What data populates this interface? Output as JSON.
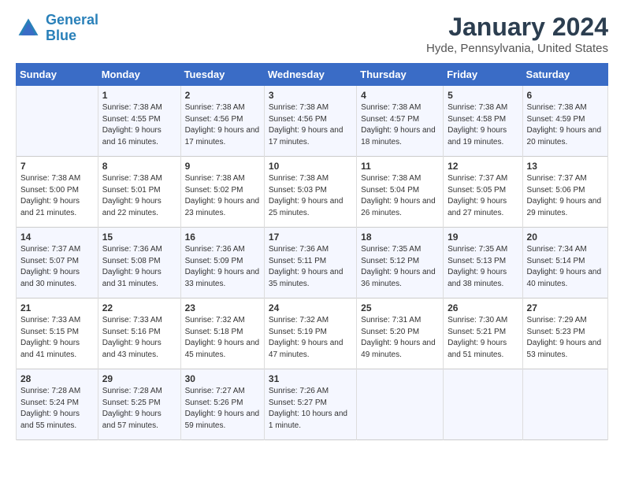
{
  "logo": {
    "line1": "General",
    "line2": "Blue"
  },
  "calendar": {
    "title": "January 2024",
    "subtitle": "Hyde, Pennsylvania, United States"
  },
  "weekdays": [
    "Sunday",
    "Monday",
    "Tuesday",
    "Wednesday",
    "Thursday",
    "Friday",
    "Saturday"
  ],
  "weeks": [
    [
      {
        "day": "",
        "sunrise": "",
        "sunset": "",
        "daylight": ""
      },
      {
        "day": "1",
        "sunrise": "Sunrise: 7:38 AM",
        "sunset": "Sunset: 4:55 PM",
        "daylight": "Daylight: 9 hours and 16 minutes."
      },
      {
        "day": "2",
        "sunrise": "Sunrise: 7:38 AM",
        "sunset": "Sunset: 4:56 PM",
        "daylight": "Daylight: 9 hours and 17 minutes."
      },
      {
        "day": "3",
        "sunrise": "Sunrise: 7:38 AM",
        "sunset": "Sunset: 4:56 PM",
        "daylight": "Daylight: 9 hours and 17 minutes."
      },
      {
        "day": "4",
        "sunrise": "Sunrise: 7:38 AM",
        "sunset": "Sunset: 4:57 PM",
        "daylight": "Daylight: 9 hours and 18 minutes."
      },
      {
        "day": "5",
        "sunrise": "Sunrise: 7:38 AM",
        "sunset": "Sunset: 4:58 PM",
        "daylight": "Daylight: 9 hours and 19 minutes."
      },
      {
        "day": "6",
        "sunrise": "Sunrise: 7:38 AM",
        "sunset": "Sunset: 4:59 PM",
        "daylight": "Daylight: 9 hours and 20 minutes."
      }
    ],
    [
      {
        "day": "7",
        "sunrise": "Sunrise: 7:38 AM",
        "sunset": "Sunset: 5:00 PM",
        "daylight": "Daylight: 9 hours and 21 minutes."
      },
      {
        "day": "8",
        "sunrise": "Sunrise: 7:38 AM",
        "sunset": "Sunset: 5:01 PM",
        "daylight": "Daylight: 9 hours and 22 minutes."
      },
      {
        "day": "9",
        "sunrise": "Sunrise: 7:38 AM",
        "sunset": "Sunset: 5:02 PM",
        "daylight": "Daylight: 9 hours and 23 minutes."
      },
      {
        "day": "10",
        "sunrise": "Sunrise: 7:38 AM",
        "sunset": "Sunset: 5:03 PM",
        "daylight": "Daylight: 9 hours and 25 minutes."
      },
      {
        "day": "11",
        "sunrise": "Sunrise: 7:38 AM",
        "sunset": "Sunset: 5:04 PM",
        "daylight": "Daylight: 9 hours and 26 minutes."
      },
      {
        "day": "12",
        "sunrise": "Sunrise: 7:37 AM",
        "sunset": "Sunset: 5:05 PM",
        "daylight": "Daylight: 9 hours and 27 minutes."
      },
      {
        "day": "13",
        "sunrise": "Sunrise: 7:37 AM",
        "sunset": "Sunset: 5:06 PM",
        "daylight": "Daylight: 9 hours and 29 minutes."
      }
    ],
    [
      {
        "day": "14",
        "sunrise": "Sunrise: 7:37 AM",
        "sunset": "Sunset: 5:07 PM",
        "daylight": "Daylight: 9 hours and 30 minutes."
      },
      {
        "day": "15",
        "sunrise": "Sunrise: 7:36 AM",
        "sunset": "Sunset: 5:08 PM",
        "daylight": "Daylight: 9 hours and 31 minutes."
      },
      {
        "day": "16",
        "sunrise": "Sunrise: 7:36 AM",
        "sunset": "Sunset: 5:09 PM",
        "daylight": "Daylight: 9 hours and 33 minutes."
      },
      {
        "day": "17",
        "sunrise": "Sunrise: 7:36 AM",
        "sunset": "Sunset: 5:11 PM",
        "daylight": "Daylight: 9 hours and 35 minutes."
      },
      {
        "day": "18",
        "sunrise": "Sunrise: 7:35 AM",
        "sunset": "Sunset: 5:12 PM",
        "daylight": "Daylight: 9 hours and 36 minutes."
      },
      {
        "day": "19",
        "sunrise": "Sunrise: 7:35 AM",
        "sunset": "Sunset: 5:13 PM",
        "daylight": "Daylight: 9 hours and 38 minutes."
      },
      {
        "day": "20",
        "sunrise": "Sunrise: 7:34 AM",
        "sunset": "Sunset: 5:14 PM",
        "daylight": "Daylight: 9 hours and 40 minutes."
      }
    ],
    [
      {
        "day": "21",
        "sunrise": "Sunrise: 7:33 AM",
        "sunset": "Sunset: 5:15 PM",
        "daylight": "Daylight: 9 hours and 41 minutes."
      },
      {
        "day": "22",
        "sunrise": "Sunrise: 7:33 AM",
        "sunset": "Sunset: 5:16 PM",
        "daylight": "Daylight: 9 hours and 43 minutes."
      },
      {
        "day": "23",
        "sunrise": "Sunrise: 7:32 AM",
        "sunset": "Sunset: 5:18 PM",
        "daylight": "Daylight: 9 hours and 45 minutes."
      },
      {
        "day": "24",
        "sunrise": "Sunrise: 7:32 AM",
        "sunset": "Sunset: 5:19 PM",
        "daylight": "Daylight: 9 hours and 47 minutes."
      },
      {
        "day": "25",
        "sunrise": "Sunrise: 7:31 AM",
        "sunset": "Sunset: 5:20 PM",
        "daylight": "Daylight: 9 hours and 49 minutes."
      },
      {
        "day": "26",
        "sunrise": "Sunrise: 7:30 AM",
        "sunset": "Sunset: 5:21 PM",
        "daylight": "Daylight: 9 hours and 51 minutes."
      },
      {
        "day": "27",
        "sunrise": "Sunrise: 7:29 AM",
        "sunset": "Sunset: 5:23 PM",
        "daylight": "Daylight: 9 hours and 53 minutes."
      }
    ],
    [
      {
        "day": "28",
        "sunrise": "Sunrise: 7:28 AM",
        "sunset": "Sunset: 5:24 PM",
        "daylight": "Daylight: 9 hours and 55 minutes."
      },
      {
        "day": "29",
        "sunrise": "Sunrise: 7:28 AM",
        "sunset": "Sunset: 5:25 PM",
        "daylight": "Daylight: 9 hours and 57 minutes."
      },
      {
        "day": "30",
        "sunrise": "Sunrise: 7:27 AM",
        "sunset": "Sunset: 5:26 PM",
        "daylight": "Daylight: 9 hours and 59 minutes."
      },
      {
        "day": "31",
        "sunrise": "Sunrise: 7:26 AM",
        "sunset": "Sunset: 5:27 PM",
        "daylight": "Daylight: 10 hours and 1 minute."
      },
      {
        "day": "",
        "sunrise": "",
        "sunset": "",
        "daylight": ""
      },
      {
        "day": "",
        "sunrise": "",
        "sunset": "",
        "daylight": ""
      },
      {
        "day": "",
        "sunrise": "",
        "sunset": "",
        "daylight": ""
      }
    ]
  ]
}
